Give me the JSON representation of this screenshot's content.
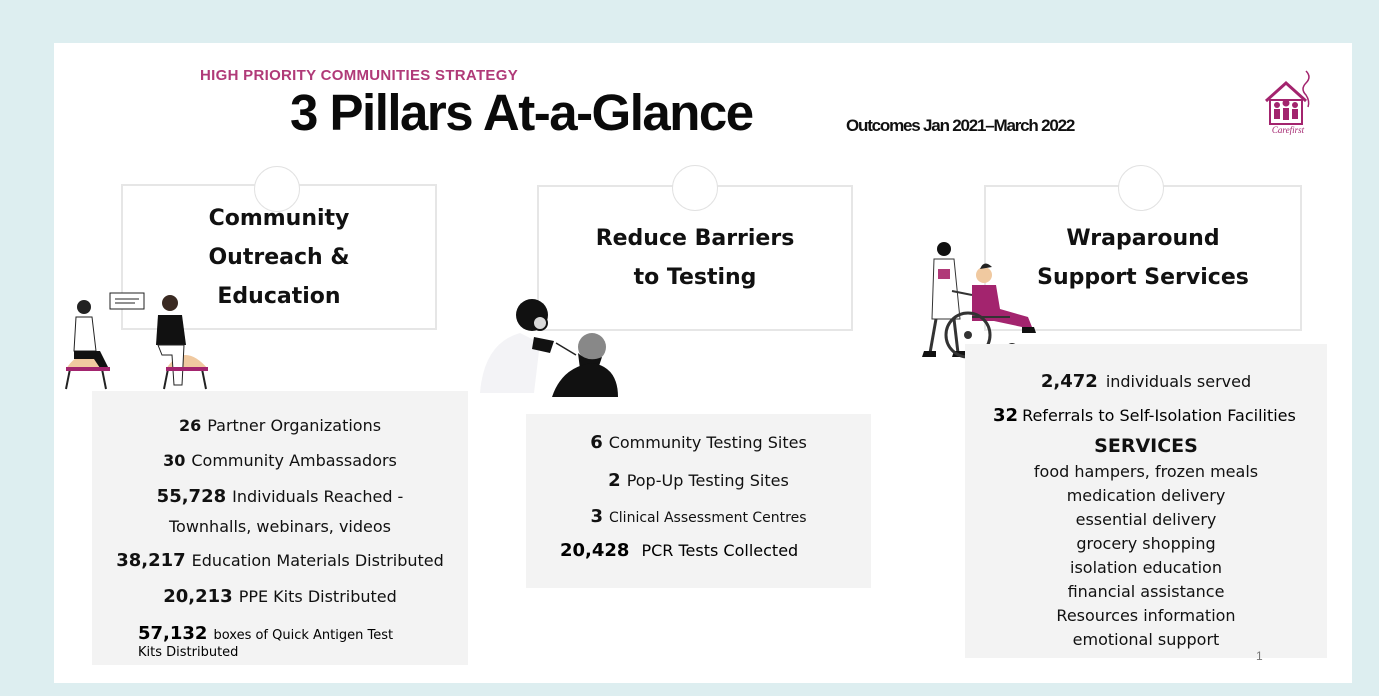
{
  "header": {
    "eyebrow": "HIGH PRIORITY COMMUNITIES STRATEGY",
    "title": "3 Pillars At-a-Glance",
    "subtitle": "Outcomes Jan 2021–March 2022",
    "logo_text": "Carefirst"
  },
  "pillars": [
    {
      "title_lines": [
        "Community",
        "Outreach &",
        "Education"
      ],
      "stats": [
        {
          "value": "26",
          "label": "Partner Organizations"
        },
        {
          "value": "30",
          "label": "Community Ambassadors"
        },
        {
          "value": "55,728",
          "label": "Individuals Reached -"
        },
        {
          "value": "",
          "label": "Townhalls, webinars, videos"
        },
        {
          "value": "38,217",
          "label": "Education Materials Distributed"
        },
        {
          "value": "20,213",
          "label": "PPE Kits Distributed"
        },
        {
          "value": "57,132",
          "label": "boxes of Quick Antigen Test"
        },
        {
          "value": "",
          "label": "Kits Distributed"
        }
      ]
    },
    {
      "title_lines": [
        "Reduce Barriers",
        "to Testing"
      ],
      "stats": [
        {
          "value": "6",
          "label": "Community Testing Sites"
        },
        {
          "value": "2",
          "label": "Pop-Up Testing Sites"
        },
        {
          "value": "3",
          "label": "Clinical Assessment Centres"
        },
        {
          "value": "20,428",
          "label": "PCR Tests Collected"
        }
      ]
    },
    {
      "title_lines": [
        "Wraparound",
        "Support Services"
      ],
      "stats": [
        {
          "value": "2,472",
          "label": "individuals served"
        },
        {
          "value": "32",
          "label": "Referrals to Self-Isolation Facilities"
        }
      ],
      "services_heading": "SERVICES",
      "services": [
        "food hampers,  frozen meals",
        "medication delivery",
        "essential delivery",
        "grocery shopping",
        "isolation education",
        "financial assistance",
        "Resources information",
        "emotional support"
      ]
    }
  ],
  "page_number": "1",
  "colors": {
    "accent": "#b03a78",
    "background": "#ddeef0",
    "panel": "#f3f3f3",
    "magenta": "#a3246e"
  }
}
